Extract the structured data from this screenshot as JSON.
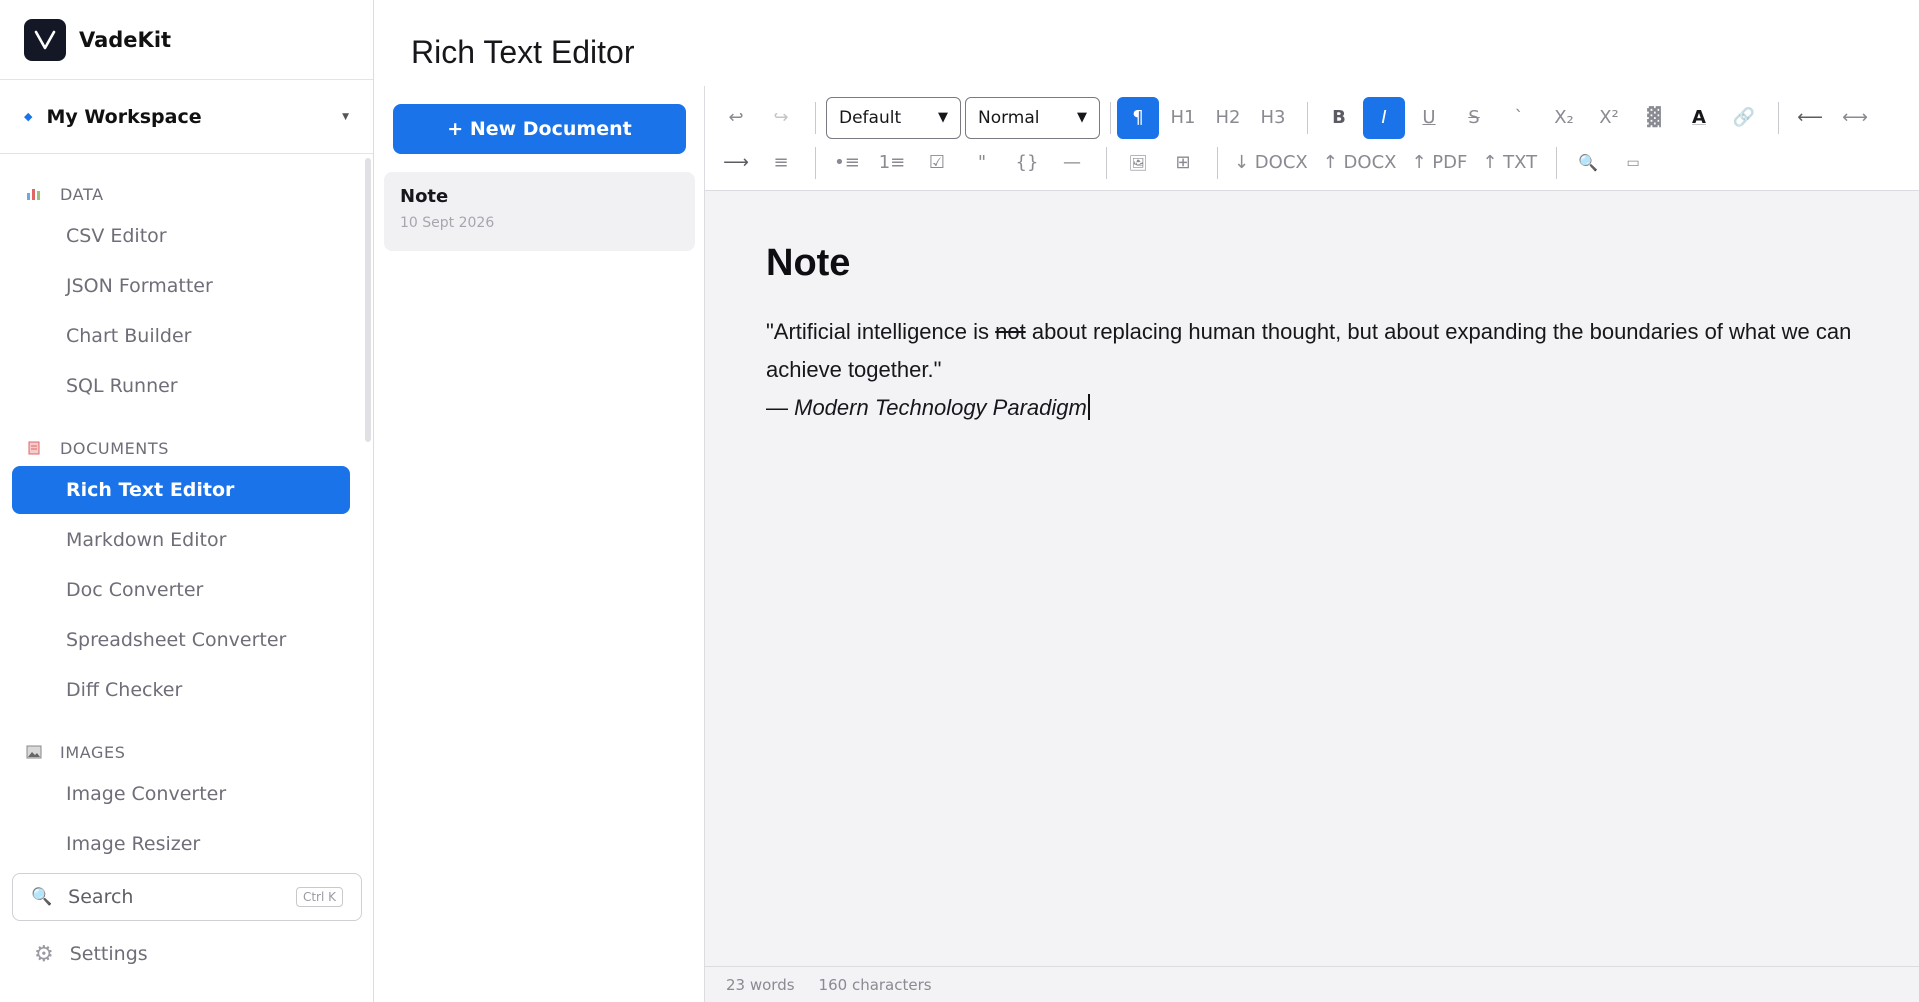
{
  "brand": {
    "name": "VadeKit",
    "logo_letter": "V",
    "accent": "#1a73e8",
    "logo_bg": "#141826"
  },
  "workspace": {
    "name": "My Workspace"
  },
  "nav": {
    "sections": [
      {
        "label": "DATA",
        "icon": "chart-icon",
        "items": [
          "CSV Editor",
          "JSON Formatter",
          "Chart Builder",
          "SQL Runner"
        ]
      },
      {
        "label": "DOCUMENTS",
        "icon": "document-icon",
        "items": [
          "Rich Text Editor",
          "Markdown Editor",
          "Doc Converter",
          "Spreadsheet Converter",
          "Diff Checker"
        ]
      },
      {
        "label": "IMAGES",
        "icon": "image-icon",
        "items": [
          "Image Converter",
          "Image Resizer"
        ]
      }
    ],
    "active": "Rich Text Editor"
  },
  "search": {
    "placeholder": "Search",
    "shortcut": "Ctrl K"
  },
  "settings": {
    "label": "Settings"
  },
  "page": {
    "title": "Rich Text Editor"
  },
  "doclist": {
    "new_button": "+ New Document",
    "documents": [
      {
        "title": "Note",
        "date": "10 Sept 2026"
      }
    ]
  },
  "toolbar": {
    "undo": "↩",
    "redo": "↪",
    "font_select": "Default",
    "size_select": "Normal",
    "paragraph": "¶",
    "h1": "H1",
    "h2": "H2",
    "h3": "H3",
    "bold": "B",
    "italic": "I",
    "underline": "U",
    "strike": "S",
    "code": "`",
    "subscript": "X₂",
    "superscript": "X²",
    "highlight": "▓",
    "text_color": "A",
    "link": "🔗",
    "align_left": "⟵",
    "align_center": "⟷",
    "align_right": "⟶",
    "justify": "≡",
    "bullet_list": "•≡",
    "numbered_list": "1≡",
    "checklist": "☑",
    "quote": "\"",
    "code_block": "{}",
    "hr": "—",
    "image": "🖼",
    "table": "⊞",
    "export_docx": "↓ DOCX",
    "import_docx": "↑ DOCX",
    "export_pdf": "↑ PDF",
    "export_txt": "↑ TXT",
    "find": "🔍",
    "clear": "▭"
  },
  "document": {
    "title": "Note",
    "para_before": "\"Artificial intelligence is ",
    "para_strike": "not",
    "para_after": " about replacing human thought, but about expanding the boundaries of what we can achieve together.\"",
    "attrib_dash": "— ",
    "attrib_text": "Modern Technology Paradigm"
  },
  "status": {
    "words": "23 words",
    "chars": "160 characters"
  }
}
